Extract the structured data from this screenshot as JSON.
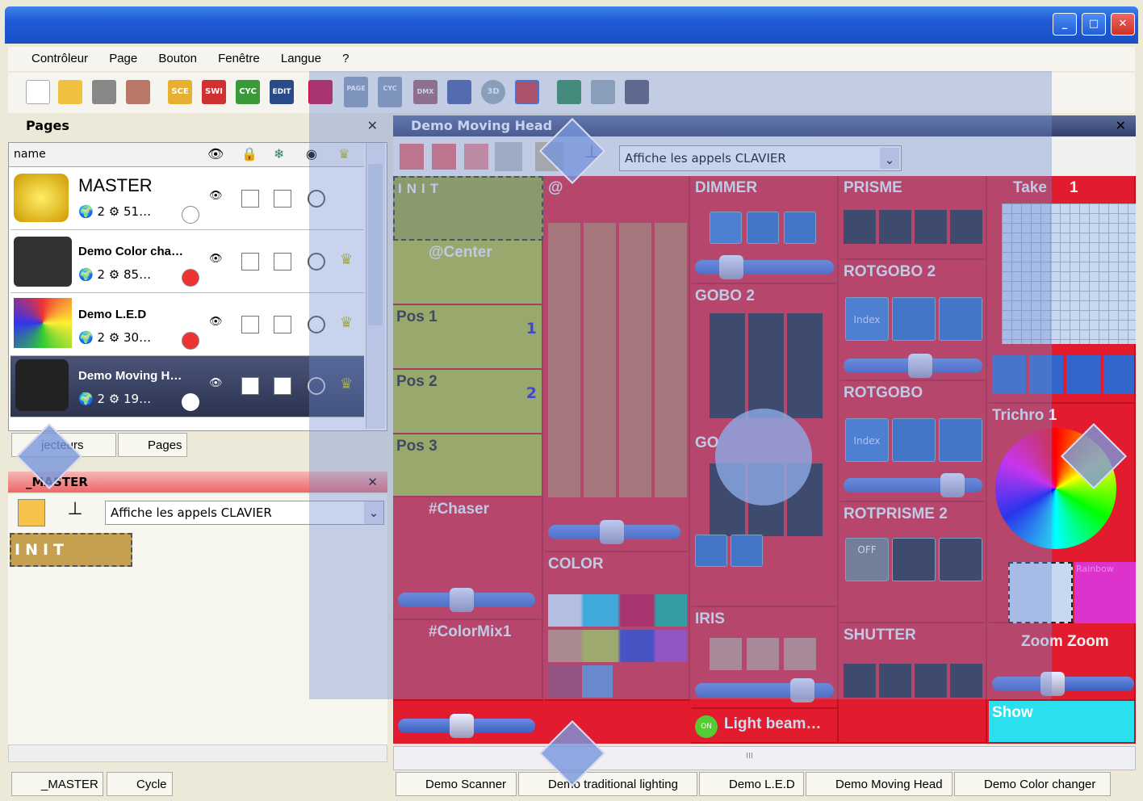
{
  "menu": [
    "Contrôleur",
    "Page",
    "Bouton",
    "Fenêtre",
    "Langue",
    "?"
  ],
  "toolbar": {
    "sce": "SCE",
    "swi": "SWI",
    "cyc": "CYC",
    "edit": "EDIT",
    "page": "PAGE",
    "cyc2": "CYC",
    "dmx": "DMX",
    "d3": "3D"
  },
  "pages_panel": {
    "title": "Pages",
    "col_name": "name",
    "rows": [
      {
        "name": "MASTER",
        "count": "2",
        "addr": "51…"
      },
      {
        "name": "Demo Color cha…",
        "count": "2",
        "addr": "85…"
      },
      {
        "name": "Demo L.E.D",
        "count": "2",
        "addr": "30…"
      },
      {
        "name": "Demo Moving H…",
        "count": "2",
        "addr": "19…"
      }
    ],
    "tabs": [
      "jecteurs",
      "Pages"
    ]
  },
  "master_panel": {
    "title": "_MASTER",
    "dropdown": "Affiche les appels CLAVIER",
    "init": "INIT"
  },
  "main": {
    "title": "Demo Moving Head",
    "dropdown": "Affiche les appels CLAVIER",
    "cells": {
      "init": "INIT",
      "center": "@Center",
      "pos1": "Pos 1",
      "pos1n": "1",
      "pos2": "Pos 2",
      "pos2n": "2",
      "pos3": "Pos 3",
      "chaser": "#Chaser",
      "colormix": "#ColorMix1",
      "at": "@",
      "color": "COLOR",
      "dimmer": "DIMMER",
      "gobo2": "GOBO 2",
      "gobo2b": "GO",
      "iris": "IRIS",
      "light": "Light beam…",
      "on": "ON",
      "prisme": "PRISME",
      "rotgobo2": "ROTGOBO 2",
      "rotgobo": "ROTGOBO",
      "rotprisme2": "ROTPRISME 2",
      "off": "OFF",
      "shutter": "SHUTTER",
      "take": "Take",
      "take1": "1",
      "trichro": "Trichro 1",
      "rainbow": "Rainbow",
      "zoom": "Zoom Zoom",
      "show": "Show",
      "index": "Index"
    }
  },
  "bottom_left_tabs": [
    "_MASTER",
    "Cycle"
  ],
  "bottom_tabs": [
    "Demo Scanner",
    "Demo traditional lighting",
    "Demo L.E.D",
    "Demo Moving Head",
    "Demo Color changer"
  ],
  "scroll_mark": "III",
  "colors": {
    "accent": "#1f5bd6",
    "cell_red": "#e21c2e",
    "cell_green": "#a8b42c"
  }
}
